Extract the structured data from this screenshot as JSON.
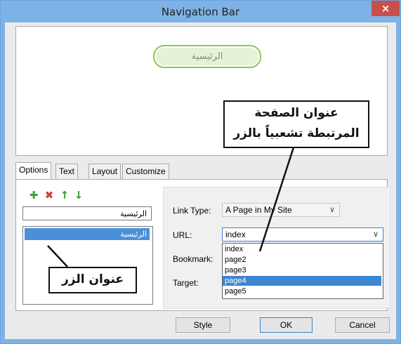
{
  "window": {
    "title": "Navigation Bar",
    "close_glyph": "×"
  },
  "preview": {
    "nav_button_label": "الرئيسية"
  },
  "tabs": [
    {
      "label": "Options"
    },
    {
      "label": "Text"
    },
    {
      "label": "Layout"
    },
    {
      "label": "Customize"
    }
  ],
  "toolbar": {
    "icons": [
      "add-icon",
      "delete-icon",
      "move-up-icon",
      "move-down-icon"
    ]
  },
  "options": {
    "button_name_value": "الرئيسية",
    "buttons_list": [
      "الرئيسية"
    ]
  },
  "props": {
    "link_type_label": "Link Type:",
    "link_type_value": "A Page in My Site",
    "url_label": "URL:",
    "url_value": "index",
    "bookmark_label": "Bookmark:",
    "target_label": "Target:",
    "url_options": [
      "index",
      "page2",
      "page3",
      "page4",
      "page5"
    ],
    "url_highlighted": "page4"
  },
  "footer": {
    "style_label": "Style",
    "ok_label": "OK",
    "cancel_label": "Cancel"
  },
  "annotations": {
    "page_title_line1": "عنوان الصفحة",
    "page_title_line2": "المرتبطة تشعبياً بالزر",
    "button_title": "عنوان الزر"
  },
  "colors": {
    "titlebar": "#7eb2e6",
    "accent": "#3d86d4",
    "nav_button_border": "#8cc65a"
  }
}
